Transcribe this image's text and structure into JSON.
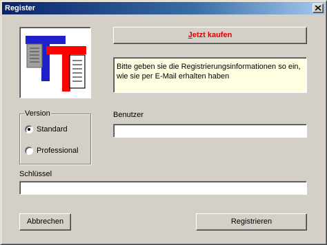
{
  "window": {
    "title": "Register"
  },
  "buy_button": {
    "accel": "J",
    "rest": "etzt kaufen"
  },
  "info_text": "Bitte geben sie die Registrierungsinformationen so ein, wie sie per E-Mail erhalten haben",
  "version": {
    "label": "Version",
    "options": [
      {
        "label": "Standard",
        "selected": true
      },
      {
        "label": "Professional",
        "selected": false
      }
    ]
  },
  "user": {
    "label": "Benutzer",
    "value": ""
  },
  "key": {
    "label": "Schlüssel",
    "value": ""
  },
  "buttons": {
    "cancel": "Abbrechen",
    "register": "Registrieren"
  },
  "icons": {
    "logo": "tt-app-logo-icon",
    "close": "close-icon"
  },
  "colors": {
    "buy_text": "#e00000",
    "info_bg": "#ffffe1",
    "title_bar": "#0a246a"
  }
}
